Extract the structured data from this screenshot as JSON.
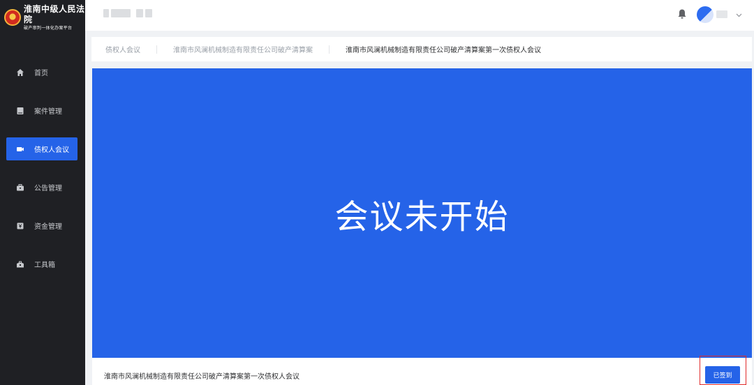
{
  "logo": {
    "title": "淮南中级人民法院",
    "subtitle": "破产审判一体化办案平台"
  },
  "sidebar": {
    "items": [
      {
        "label": "首页",
        "icon": "home-icon",
        "active": false
      },
      {
        "label": "案件管理",
        "icon": "folder-icon",
        "active": false
      },
      {
        "label": "债权人会议",
        "icon": "video-camera-icon",
        "active": true
      },
      {
        "label": "公告管理",
        "icon": "briefcase-icon",
        "active": false
      },
      {
        "label": "资金管理",
        "icon": "money-icon",
        "active": false
      },
      {
        "label": "工具箱",
        "icon": "toolbox-icon",
        "active": false
      }
    ]
  },
  "breadcrumb": {
    "items": [
      "债权人会议",
      "淮南市风澜机械制造有限责任公司破产清算案",
      "淮南市风澜机械制造有限责任公司破产清算案第一次债权人会议"
    ]
  },
  "video": {
    "status_text": "会议未开始"
  },
  "bottom": {
    "meeting_title": "淮南市风澜机械制造有限责任公司破产清算案第一次债权人会议",
    "signed_button": "已签到"
  },
  "colors": {
    "accent": "#2563e8",
    "sidebar_bg": "#1f2024",
    "highlight": "#e02b2b"
  }
}
